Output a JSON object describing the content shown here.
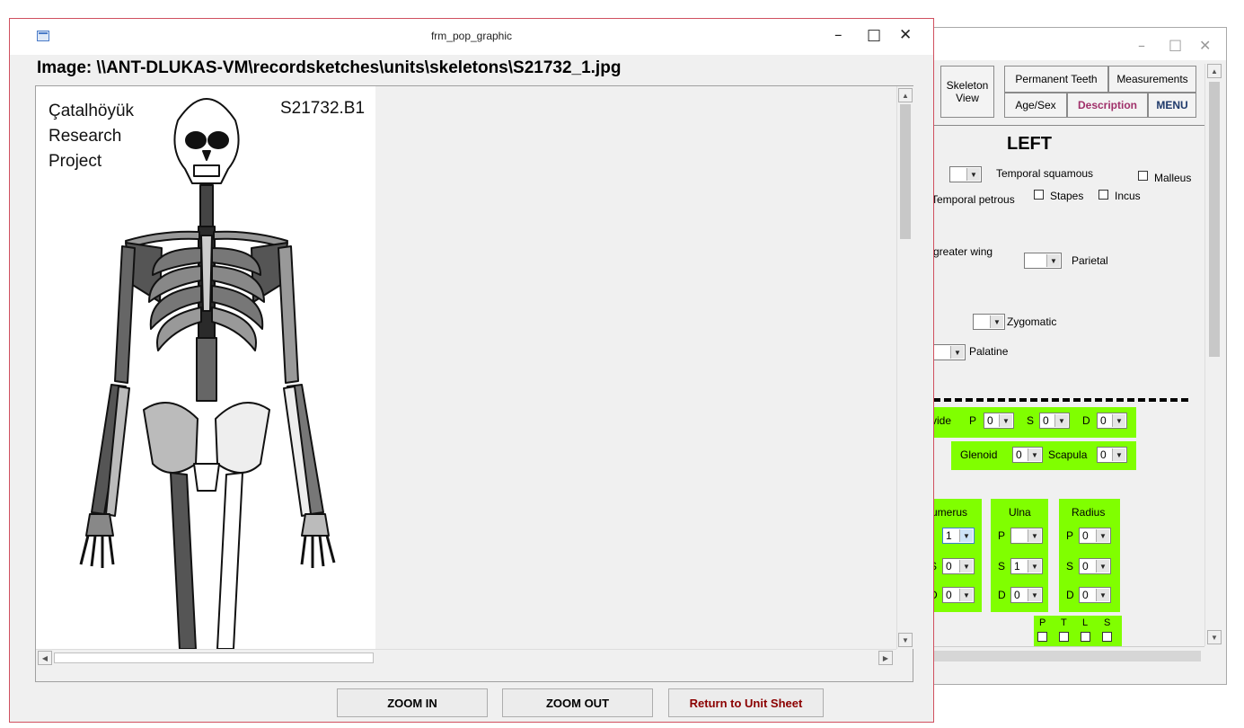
{
  "back_window": {
    "window_controls": {
      "minimize": "–",
      "maximize": "□",
      "close": "✕"
    },
    "tabs": {
      "skeleton_view": "Skeleton View",
      "permanent_teeth": "Permanent Teeth",
      "measurements": "Measurements",
      "age_sex": "Age/Sex",
      "description": "Description",
      "menu": "MENU"
    },
    "section_title": "LEFT",
    "labels": {
      "temporal_squamous": "Temporal squamous",
      "malleus": "Malleus",
      "temporal_petrous": "Temporal petrous",
      "stapes": "Stapes",
      "incus": "Incus",
      "greater_wing": "greater wing",
      "parietal": "Parietal",
      "zygomatic": "Zygomatic",
      "palatine": "Palatine",
      "clavicle_partial": "vide",
      "p": "P",
      "s": "S",
      "d": "D",
      "glenoid": "Glenoid",
      "scapula": "Scapula",
      "humerus_partial": "umerus",
      "ulna": "Ulna",
      "radius": "Radius",
      "s_partial": "S",
      "d_partial": "D",
      "t": "T",
      "l": "L"
    },
    "values": {
      "clav_p": "0",
      "clav_s": "0",
      "clav_d": "0",
      "glenoid": "0",
      "scapula": "0",
      "hum_p": "1",
      "hum_s": "0",
      "hum_d": "0",
      "ulna_p": "",
      "ulna_s": "1",
      "ulna_d": "0",
      "rad_p": "0",
      "rad_s": "0",
      "rad_d": "0"
    }
  },
  "front_window": {
    "title": "frm_pop_graphic",
    "window_controls": {
      "minimize": "–",
      "maximize": "□",
      "close": "✕"
    },
    "image_path": "Image: \\\\ANT-DLUKAS-VM\\recordsketches\\units\\skeletons\\S21732_1.jpg",
    "sketch": {
      "org_line1": "Çatalhöyük",
      "org_line2": "Research",
      "org_line3": "Project",
      "code": "S21732.B1"
    },
    "buttons": {
      "zoom_in": "ZOOM IN",
      "zoom_out": "ZOOM OUT",
      "return": "Return to Unit Sheet"
    }
  },
  "colors": {
    "accent_green": "#80ff00",
    "description_tab": "#a0306a",
    "menu_tab": "#1f3a6b",
    "return_button_text": "#8b0000",
    "front_border": "#d0505f"
  }
}
